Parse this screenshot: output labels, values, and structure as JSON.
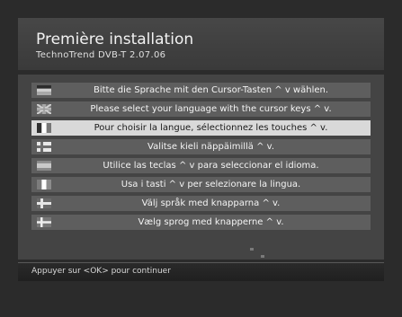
{
  "header": {
    "title": "Première installation",
    "subtitle": "TechnoTrend  DVB-T  2.07.06"
  },
  "languages": [
    {
      "label": "Bitte die Sprache mit den Cursor-Tasten ^  v wählen.",
      "flag_icon": "german-flag-icon",
      "selected": false
    },
    {
      "label": "Please select your language with the cursor keys ^  v.",
      "flag_icon": "uk-flag-icon",
      "selected": false
    },
    {
      "label": "Pour choisir la langue, sélectionnez les touches ^  v.",
      "flag_icon": "french-flag-icon",
      "selected": true
    },
    {
      "label": "Valitse kieli näppäimillä ^  v.",
      "flag_icon": "finnish-flag-icon",
      "selected": false
    },
    {
      "label": "Utilice las teclas ^  v para seleccionar el idioma.",
      "flag_icon": "spanish-flag-icon",
      "selected": false
    },
    {
      "label": "Usa i tasti ^  v per selezionare la lingua.",
      "flag_icon": "italian-flag-icon",
      "selected": false
    },
    {
      "label": "Välj språk med knapparna ^  v.",
      "flag_icon": "swedish-flag-icon",
      "selected": false
    },
    {
      "label": "Vælg sprog med knapperne ^  v.",
      "flag_icon": "danish-flag-icon",
      "selected": false
    }
  ],
  "footer": {
    "hint": "Appuyer sur <OK> pour continuer"
  },
  "colors": {
    "background": "#2b2b2b",
    "panel": "#444444",
    "row": "#5e5e5e",
    "row_selected": "#d9d9d9",
    "text": "#f4f4f4",
    "text_selected": "#1a1a1a"
  }
}
